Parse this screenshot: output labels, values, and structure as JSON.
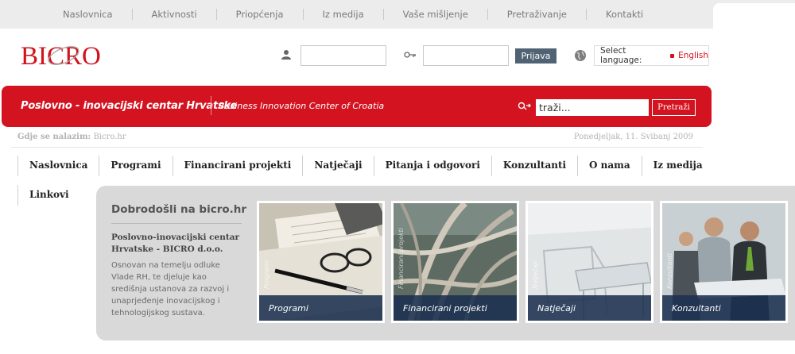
{
  "topnav": {
    "items": [
      "Naslovnica",
      "Aktivnosti",
      "Priopćenja",
      "Iz medija",
      "Vaše mišljenje",
      "Pretraživanje",
      "Kontakti"
    ]
  },
  "logo": {
    "text": "BICRO"
  },
  "login": {
    "username_value": "",
    "password_value": "",
    "submit_label": "Prijava",
    "icons": [
      "user-icon",
      "key-icon"
    ]
  },
  "language": {
    "label": "Select language:",
    "option": "English",
    "icon": "globe-icon"
  },
  "banner": {
    "title": "Poslovno - inovacijski centar Hrvatske",
    "subtitle": "Business Innovation Center of Croatia",
    "search_value": "traži...",
    "search_button": "Pretraži",
    "colors": {
      "red": "#d41320"
    }
  },
  "breadcrumb": {
    "label": "Gdje se nalazim:",
    "current": "Bicro.hr",
    "date": "Ponedjeljak, 11. Svibanj 2009"
  },
  "mainmenu": {
    "items": [
      "Naslovnica",
      "Programi",
      "Financirani projekti",
      "Natječaji",
      "Pitanja i odgovori",
      "Konzultanti",
      "O nama",
      "Iz medija"
    ],
    "second_row": "Linkovi"
  },
  "welcome": {
    "title": "Dobrodošli na bicro.hr",
    "org": "Poslovno-inovacijski centar Hrvatske - BICRO d.o.o.",
    "description": "Osnovan na temelju odluke Vlade RH, te djeluje kao središnja ustanova za razvoj i unaprjeđenje inovacijskog i tehnologijskog sustava."
  },
  "tiles": [
    {
      "label": "Programi",
      "vertical": "Programi"
    },
    {
      "label": "Financirani projekti",
      "vertical": "Financirani projekti"
    },
    {
      "label": "Natječaji",
      "vertical": "Natječaji"
    },
    {
      "label": "Konzultanti",
      "vertical": "Konzultanti"
    }
  ]
}
